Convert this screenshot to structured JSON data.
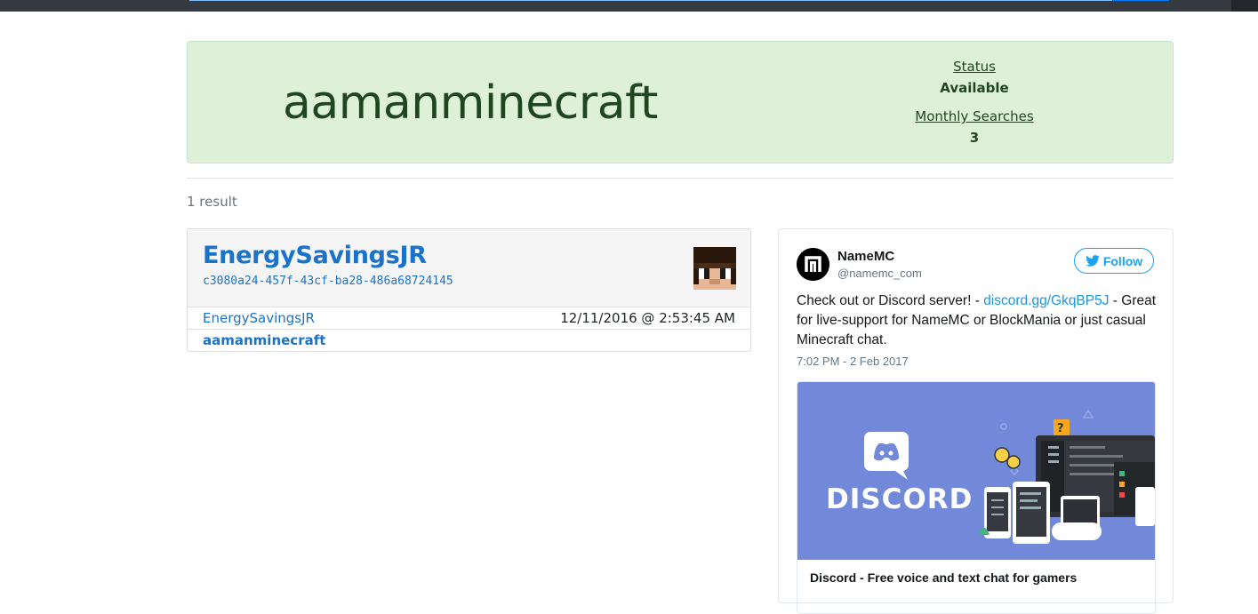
{
  "banner": {
    "username": "aamanminecraft",
    "status_label": "Status",
    "status_value": "Available",
    "monthly_label": "Monthly Searches",
    "monthly_value": "3"
  },
  "results": {
    "count_text": "1 result",
    "card": {
      "name": "EnergySavingsJR",
      "uuid": "c3080a24-457f-43cf-ba28-486a68724145",
      "history": [
        {
          "name": "EnergySavingsJR",
          "date": "12/11/2016 @ 2:53:45 AM"
        },
        {
          "name": "aamanminecraft",
          "date": ""
        }
      ]
    }
  },
  "tweet": {
    "account_name": "NameMC",
    "handle": "@namemc_com",
    "follow_label": "Follow",
    "text_before": "Check out or Discord server! - ",
    "text_link": "discord.gg/GkqBP5J",
    "text_after": " - Great for live-support for NameMC or BlockMania or just casual Minecraft chat.",
    "time": "7:02 PM - 2 Feb 2017",
    "media_wordmark": "DISCORD",
    "media_caption": "Discord - Free voice and text chat for gamers",
    "colors": {
      "brand": "#1da1f2",
      "discord": "#7289da"
    }
  }
}
